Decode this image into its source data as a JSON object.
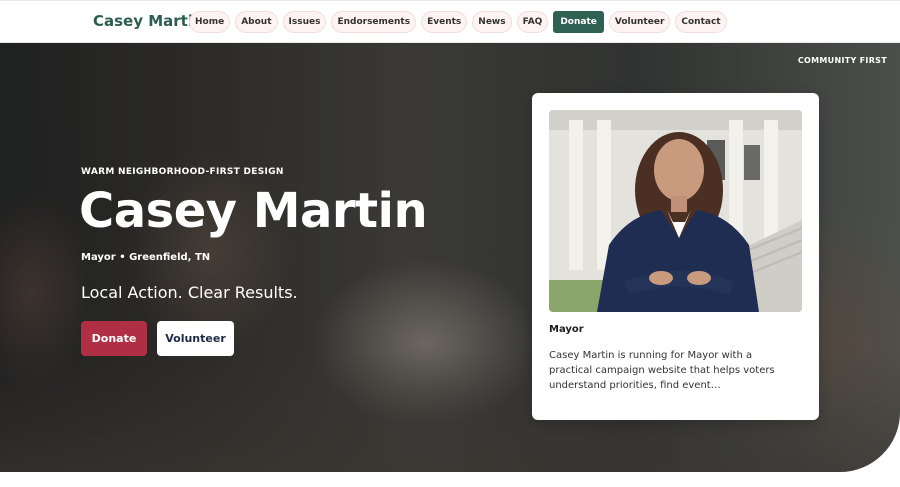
{
  "nav": {
    "brand": "Casey Martin",
    "links": [
      "Home",
      "About",
      "Issues",
      "Endorsements",
      "Events",
      "News",
      "FAQ",
      "Donate",
      "Volunteer",
      "Contact"
    ]
  },
  "hero": {
    "corner_tag": "COMMUNITY FIRST",
    "eyebrow": "WARM NEIGHBORHOOD-FIRST DESIGN",
    "title": "Casey Martin",
    "office": "Mayor • Greenfield, TN",
    "tagline": "Local Action. Clear Results.",
    "donate_label": "Donate",
    "volunteer_label": "Volunteer"
  },
  "card": {
    "label": "Mayor",
    "text": "Casey Martin is running for Mayor with a practical campaign website that helps voters understand priorities, find event…"
  },
  "colors": {
    "brand_green": "#2f6252",
    "donate_red": "#b12f45",
    "nav_pill": "#fdf3f3"
  }
}
